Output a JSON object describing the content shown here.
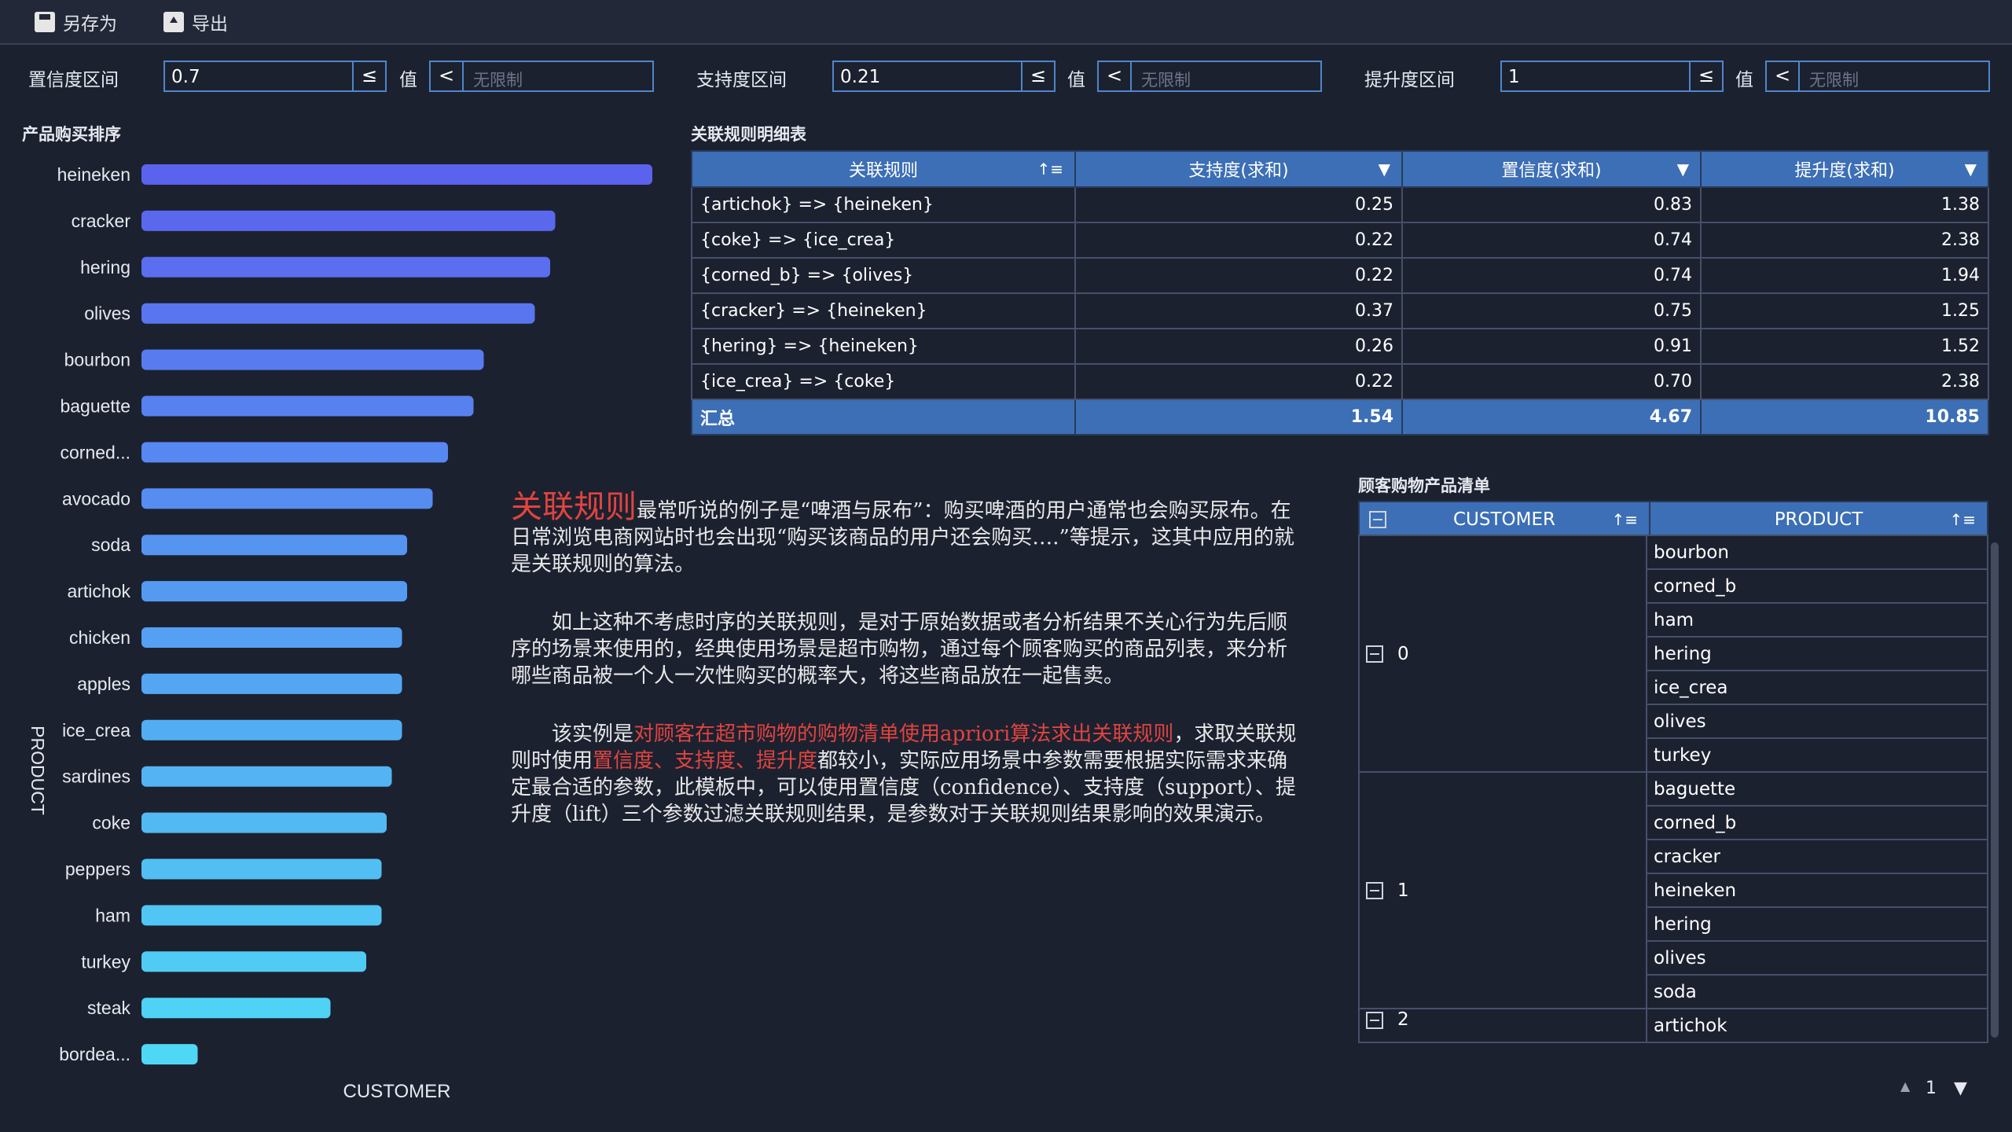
{
  "toolbar": {
    "save_as": "另存为",
    "export": "导出"
  },
  "filters": {
    "confidence": {
      "label": "置信度区间",
      "value": "0.7",
      "op": "≤",
      "value_label": "值",
      "op2": "<",
      "placeholder": "无限制"
    },
    "support": {
      "label": "支持度区间",
      "value": "0.21",
      "op": "≤",
      "value_label": "值",
      "op2": "<",
      "placeholder": "无限制"
    },
    "lift": {
      "label": "提升度区间",
      "value": "1",
      "op": "≤",
      "value_label": "值",
      "op2": "<",
      "placeholder": "无限制"
    }
  },
  "ranking": {
    "title": "产品购买排序"
  },
  "chart_data": {
    "type": "bar",
    "orientation": "horizontal",
    "ylabel": "PRODUCT",
    "xlabel": "CUSTOMER",
    "categories": [
      "heineken",
      "cracker",
      "hering",
      "olives",
      "bourbon",
      "baguette",
      "corned...",
      "avocado",
      "soda",
      "artichok",
      "chicken",
      "apples",
      "ice_crea",
      "sardines",
      "coke",
      "peppers",
      "ham",
      "turkey",
      "steak",
      "bordea..."
    ],
    "values": [
      100,
      81,
      80,
      77,
      67,
      65,
      60,
      57,
      52,
      52,
      51,
      51,
      51,
      49,
      48,
      47,
      47,
      44,
      37,
      11
    ],
    "gradient": [
      "#5b62ee",
      "#4fd8f5"
    ]
  },
  "rules_table": {
    "title": "关联规则明细表",
    "headers": [
      "关联规则",
      "支持度(求和)",
      "置信度(求和)",
      "提升度(求和)"
    ],
    "rows": [
      [
        "{artichok} => {heineken}",
        "0.25",
        "0.83",
        "1.38"
      ],
      [
        "{coke} => {ice_crea}",
        "0.22",
        "0.74",
        "2.38"
      ],
      [
        "{corned_b} => {olives}",
        "0.22",
        "0.74",
        "1.94"
      ],
      [
        "{cracker} => {heineken}",
        "0.37",
        "0.75",
        "1.25"
      ],
      [
        "{hering} => {heineken}",
        "0.26",
        "0.91",
        "1.52"
      ],
      [
        "{ice_crea} => {coke}",
        "0.22",
        "0.70",
        "2.38"
      ]
    ],
    "total": [
      "汇总",
      "1.54",
      "4.67",
      "10.85"
    ]
  },
  "description": {
    "p1_big": "关联规则",
    "p1_rest": "最常听说的例子是“啤酒与尿布”：购买啤酒的用户通常也会购买尿布。在日常浏览电商网站时也会出现“购买该商品的用户还会购买….”等提示，这其中应用的就是关联规则的算法。",
    "p2": "如上这种不考虑时序的关联规则，是对于原始数据或者分析结果不关心行为先后顺序的场景来使用的，经典使用场景是超市购物，通过每个顾客购买的商品列表，来分析哪些商品被一个人一次性购买的概率大，将这些商品放在一起售卖。",
    "p3_a": "该实例是",
    "p3_red1": "对顾客在超市购物的购物清单使用apriori算法求出关联规则",
    "p3_b": "，求取关联规则时使用",
    "p3_red2": "置信度、支持度、提升度",
    "p3_c": "都较小，实际应用场景中参数需要根据实际需求来确定最合适的参数，此模板中，可以使用置信度（confidence）、支持度（support）、提升度（lift）三个参数过滤关联规则结果，是参数对于关联规则结果影响的效果演示。"
  },
  "customer_table": {
    "title": "顾客购物产品清单",
    "headers": [
      "CUSTOMER",
      "PRODUCT"
    ],
    "groups": [
      {
        "customer": "0",
        "products": [
          "bourbon",
          "corned_b",
          "ham",
          "hering",
          "ice_crea",
          "olives",
          "turkey"
        ]
      },
      {
        "customer": "1",
        "products": [
          "baguette",
          "corned_b",
          "cracker",
          "heineken",
          "hering",
          "olives",
          "soda"
        ]
      },
      {
        "customer": "2",
        "products": [
          "artichok"
        ]
      }
    ]
  },
  "pager": {
    "page": "1"
  }
}
